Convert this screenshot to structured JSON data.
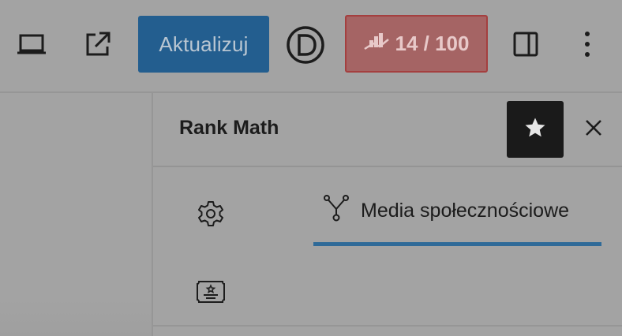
{
  "toolbar": {
    "preview_icon": "laptop-icon",
    "external_icon": "external-link-icon",
    "update_label": "Aktualizuj",
    "divi_icon": "divi-logo-icon",
    "score_icon": "rank-math-score-icon",
    "score_label": "14 / 100",
    "sidebar_toggle_icon": "sidebar-toggle-icon",
    "more_icon": "more-vertical-icon"
  },
  "panel": {
    "title": "Rank Math",
    "star_icon": "star-icon",
    "close_icon": "close-icon",
    "tabs": [
      {
        "icon": "gear-icon",
        "label": ""
      },
      {
        "icon": "social-share-icon",
        "label": "Media społecznościowe"
      },
      {
        "icon": "certificate-icon",
        "label": ""
      }
    ]
  },
  "colors": {
    "update_button": "#235e8f",
    "score_button": "#a56464",
    "active_tab_underline": "#2f6a98",
    "star_button": "#1a1a1a"
  }
}
